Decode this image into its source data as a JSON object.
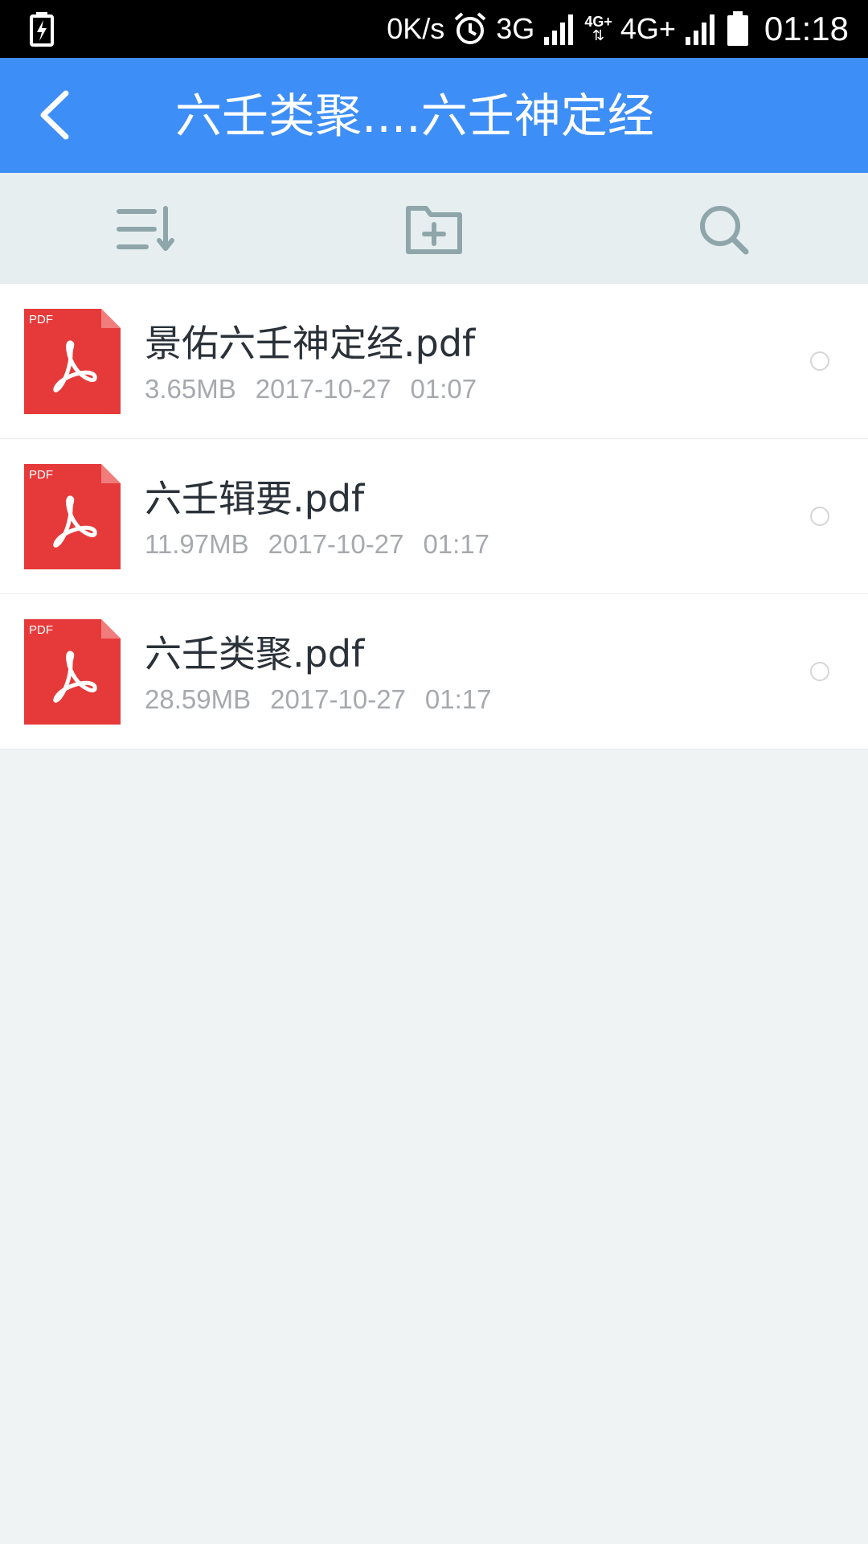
{
  "status_bar": {
    "net_speed": "0K/s",
    "net1": "3G",
    "net2_small": "4G+",
    "net2": "4G+",
    "time": "01:18",
    "icons": [
      "battery-charging-icon",
      "alarm-icon",
      "signal-icon",
      "battery-icon"
    ]
  },
  "header": {
    "title": "六壬类聚....六壬神定经",
    "back_icon": "chevron-left-icon",
    "color": "#3e8ef7"
  },
  "toolbar": {
    "icons": [
      "sort-icon",
      "new-folder-icon",
      "search-icon"
    ]
  },
  "files": [
    {
      "name": "景佑六壬神定经.pdf",
      "size": "3.65MB",
      "date": "2017-10-27",
      "time": "01:07",
      "badge": "PDF"
    },
    {
      "name": "六壬辑要.pdf",
      "size": "11.97MB",
      "date": "2017-10-27",
      "time": "01:17",
      "badge": "PDF"
    },
    {
      "name": "六壬类聚.pdf",
      "size": "28.59MB",
      "date": "2017-10-27",
      "time": "01:17",
      "badge": "PDF"
    }
  ],
  "colors": {
    "pdf_red": "#e63a3a",
    "icon_gray": "#8ea6aa",
    "background": "#eff3f3"
  }
}
